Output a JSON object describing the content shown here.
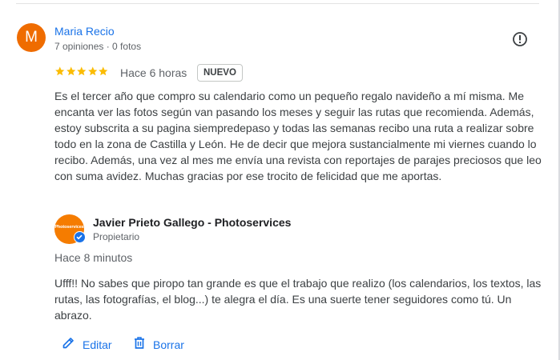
{
  "review": {
    "avatar_letter": "M",
    "author_name": "Maria Recio",
    "author_meta": "7 opiniones · 0 fotos",
    "rating": 5,
    "time": "Hace 6 horas",
    "badge": "NUEVO",
    "text": "Es el tercer año que compro su calendario como un pequeño regalo navideño a mí misma. Me encanta ver las fotos según van pasando los meses y seguir las rutas que recomienda. Además, estoy subscrita a su pagina siempredepaso y todas las semanas recibo una ruta a realizar sobre todo en la zona de Castilla y León. He de decir que mejora sustancialmente mi viernes cuando lo recibo. Además, una vez al mes me envía una revista con reportajes de parajes preciosos que leo con suma avidez. Muchas gracias por ese trocito de felicidad que me aportas."
  },
  "owner_reply": {
    "logo_text": "Photoservices",
    "owner_name": "Javier Prieto Gallego - Photoservices",
    "owner_role": "Propietario",
    "time": "Hace 8 minutos",
    "text": "Ufff!! No sabes que piropo tan grande es que el trabajo que realizo (los calendarios, los textos, las rutas, las fotografías, el blog...) te alegra el día. Es una suerte tener seguidores como tú. Un abrazo."
  },
  "actions": {
    "edit_label": "Editar",
    "delete_label": "Borrar"
  },
  "icons": {
    "report": "report-flag-icon",
    "star": "star-icon",
    "verified": "verified-check-icon",
    "edit": "pencil-icon",
    "delete": "trash-icon"
  },
  "colors": {
    "link_blue": "#1a73e8",
    "star_gold": "#fbbc04",
    "avatar_orange": "#ef6c00"
  }
}
